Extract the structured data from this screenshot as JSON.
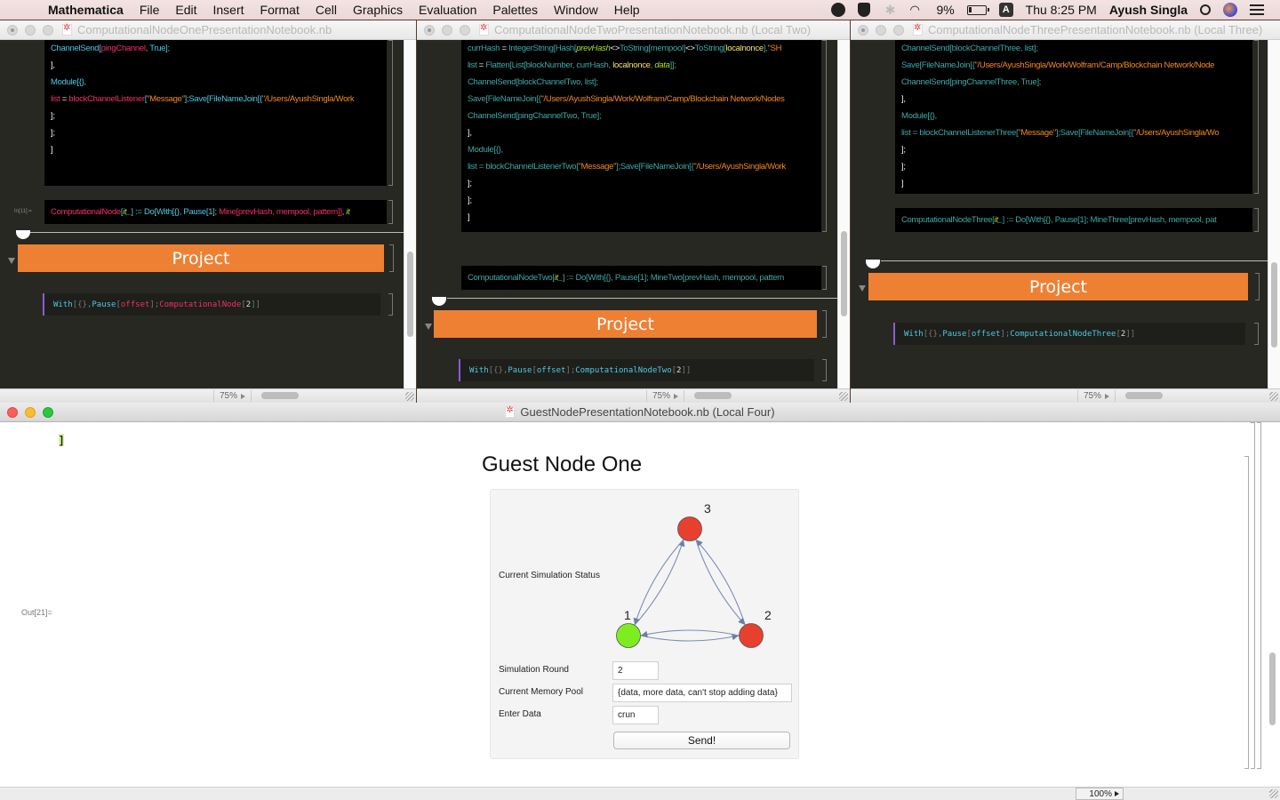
{
  "menubar": {
    "app_name": "Mathematica",
    "items": [
      "File",
      "Edit",
      "Insert",
      "Format",
      "Cell",
      "Graphics",
      "Evaluation",
      "Palettes",
      "Window",
      "Help"
    ],
    "battery": "9%",
    "input_source": "A",
    "clock": "Thu 8:25 PM",
    "user": "Ayush Singla"
  },
  "windows": [
    {
      "title": "ComputationalNodeOnePresentationNotebook.nb",
      "code_lines": [
        [
          [
            "fn",
            "ChannelSend["
          ],
          [
            "var",
            "pingChannel"
          ],
          [
            "fn",
            ", True];"
          ]
        ],
        [
          [
            "white",
            "],"
          ]
        ],
        [
          [
            "fn",
            "Module[{},"
          ]
        ],
        [
          [
            "var",
            " list"
          ],
          [
            "white",
            " = "
          ],
          [
            "var",
            "blockChannelListener"
          ],
          [
            "fn",
            "["
          ],
          [
            "str",
            "\"Message\""
          ],
          [
            "fn",
            "];Save[FileNameJoin[{"
          ],
          [
            "str",
            "\"/Users/AyushSingla/Work"
          ]
        ],
        [
          [
            "white",
            "];"
          ]
        ],
        [
          [
            "white",
            "];"
          ]
        ],
        [
          [
            "white",
            "]"
          ]
        ]
      ],
      "in_label": "In[11]:=",
      "def_line": [
        [
          "var",
          "ComputationalNode"
        ],
        [
          "fn",
          "["
        ],
        [
          "ital",
          "it_"
        ],
        [
          "fn",
          "] := Do[With[{}, Pause[1]; "
        ],
        [
          "var",
          "Mine[prevHash, mempool, pattern]]"
        ],
        [
          "fn",
          ", "
        ],
        [
          "ital",
          "it"
        ]
      ],
      "section_title": "Project",
      "input_cell": [
        [
          "fn",
          "With"
        ],
        [
          "punct",
          "[{}, "
        ],
        [
          "fn",
          "Pause"
        ],
        [
          "punct",
          "["
        ],
        [
          "var",
          "offset"
        ],
        [
          "punct",
          "]; "
        ],
        [
          "var",
          "ComputationalNode"
        ],
        [
          "punct",
          "["
        ],
        [
          "num",
          "2"
        ],
        [
          "punct",
          "]]"
        ]
      ],
      "zoom": "75%"
    },
    {
      "title": "ComputationalNodeTwoPresentationNotebook.nb (Local Two)",
      "code_lines": [
        [
          [
            "teal",
            "currHash"
          ],
          [
            "white",
            " = "
          ],
          [
            "teal",
            "IntegerString[Hash["
          ],
          [
            "ital",
            "prevHash"
          ],
          [
            "white",
            "<>"
          ],
          [
            "teal",
            "ToString[mempool]"
          ],
          [
            "white",
            "<>"
          ],
          [
            "teal",
            "ToString["
          ],
          [
            "yel",
            "localnonce"
          ],
          [
            "teal",
            "],"
          ],
          [
            "str",
            "\"SH"
          ]
        ],
        [
          [
            "teal",
            "list"
          ],
          [
            "white",
            " = "
          ],
          [
            "teal",
            "Flatten[List[blockNumber, currHash, "
          ],
          [
            "yel",
            "localnonce"
          ],
          [
            "teal",
            ", "
          ],
          [
            "ital",
            "data"
          ],
          [
            "teal",
            "]];"
          ]
        ],
        [
          [
            "teal",
            " ChannelSend[blockChannelTwo, list];"
          ]
        ],
        [
          [
            "teal",
            "Save[FileNameJoin[{"
          ],
          [
            "str",
            "\"/Users/AyushSingla/Work/Wolfram/Camp/Blockchain Network/Nodes"
          ]
        ],
        [
          [
            "teal",
            "ChannelSend[pingChannelTwo, True];"
          ]
        ],
        [
          [
            "white",
            "],"
          ]
        ],
        [
          [
            "teal",
            "Module[{},"
          ]
        ],
        [
          [
            "teal",
            " list = blockChannelListenerTwo["
          ],
          [
            "str",
            "\"Message\""
          ],
          [
            "teal",
            "];Save[FileNameJoin[{"
          ],
          [
            "str",
            "\"/Users/AyushSingla/Work"
          ]
        ],
        [
          [
            "white",
            "];"
          ]
        ],
        [
          [
            "white",
            "];"
          ]
        ],
        [
          [
            "white",
            "]"
          ]
        ]
      ],
      "def_line": [
        [
          "teal",
          "ComputationalNodeTwo["
        ],
        [
          "ital",
          "it_"
        ],
        [
          "teal",
          "] := Do[With[{}, Pause[1]; MineTwo[prevHash, mempool, pattern"
        ]
      ],
      "section_title": "Project",
      "input_cell": [
        [
          "fn",
          "With"
        ],
        [
          "punct",
          "[{}, "
        ],
        [
          "fn",
          "Pause"
        ],
        [
          "punct",
          "["
        ],
        [
          "fn",
          "offset"
        ],
        [
          "punct",
          "]; "
        ],
        [
          "fn",
          "ComputationalNodeTwo"
        ],
        [
          "punct",
          "["
        ],
        [
          "num",
          "2"
        ],
        [
          "punct",
          "]]"
        ]
      ],
      "zoom": "75%"
    },
    {
      "title": "ComputationalNodeThreePresentationNotebook.nb (Local Three)",
      "code_lines": [
        [
          [
            "teal",
            " ChannelSend[blockChannelThree, list];"
          ]
        ],
        [
          [
            "teal",
            "Save[FileNameJoin[{"
          ],
          [
            "str",
            "\"/Users/AyushSingla/Work/Wolfram/Camp/Blockchain Network/Node"
          ]
        ],
        [
          [
            "teal",
            "ChannelSend[pingChannelThree, True];"
          ]
        ],
        [
          [
            "white",
            "],"
          ]
        ],
        [
          [
            "teal",
            "Module[{},"
          ]
        ],
        [
          [
            "teal",
            " list = blockChannelListenerThree["
          ],
          [
            "str",
            "\"Message\""
          ],
          [
            "teal",
            "];Save[FileNameJoin[{"
          ],
          [
            "str",
            "\"/Users/AyushSingla/Wo"
          ]
        ],
        [
          [
            "white",
            "];"
          ]
        ],
        [
          [
            "white",
            "];"
          ]
        ],
        [
          [
            "white",
            "]"
          ]
        ]
      ],
      "def_line": [
        [
          "teal",
          "ComputationalNodeThree["
        ],
        [
          "ital",
          "it_"
        ],
        [
          "teal",
          "] := Do[With[{}, Pause[1]; MineThree[prevHash, mempool, pat"
        ]
      ],
      "section_title": "Project",
      "input_cell": [
        [
          "fn",
          "With"
        ],
        [
          "punct",
          "[{}, "
        ],
        [
          "fn",
          "Pause"
        ],
        [
          "punct",
          "["
        ],
        [
          "fn",
          "offset"
        ],
        [
          "punct",
          "]; "
        ],
        [
          "fn",
          "ComputationalNodeThree"
        ],
        [
          "punct",
          "["
        ],
        [
          "num",
          "2"
        ],
        [
          "punct",
          "]]"
        ]
      ],
      "zoom": "75%"
    }
  ],
  "guest": {
    "title": "GuestNodePresentationNotebook.nb (Local Four)",
    "out_label": "Out[21]=",
    "panel_title": "Guest Node One",
    "status_label": "Current Simulation Status",
    "graph": {
      "nodes": [
        {
          "id": "1",
          "color": "#7ded1f"
        },
        {
          "id": "2",
          "color": "#e8402f"
        },
        {
          "id": "3",
          "color": "#e8402f"
        }
      ],
      "edges": [
        [
          "1",
          "2"
        ],
        [
          "2",
          "1"
        ],
        [
          "1",
          "3"
        ],
        [
          "3",
          "1"
        ],
        [
          "2",
          "3"
        ],
        [
          "3",
          "2"
        ]
      ]
    },
    "fields": [
      {
        "label": "Simulation Round",
        "value": "2"
      },
      {
        "label": "Current Memory Pool",
        "value": "{data, more data, can't stop adding data}"
      },
      {
        "label": "Enter Data",
        "value": "crun"
      }
    ],
    "send_label": "Send!",
    "zoom": "100%"
  }
}
